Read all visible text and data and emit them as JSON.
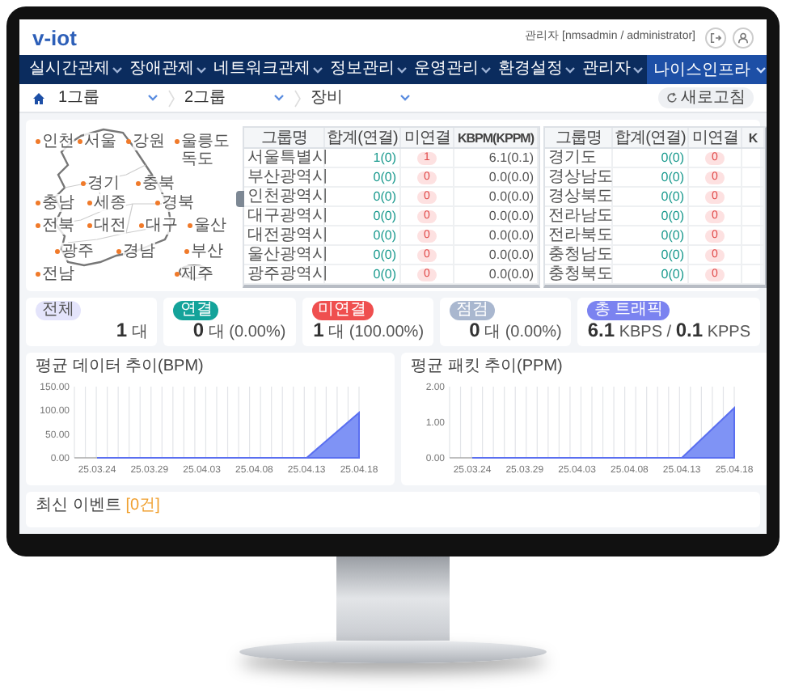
{
  "header": {
    "logo": "v-iot",
    "user": "관리자 [nmsadmin / administrator]"
  },
  "nav": {
    "items": [
      {
        "label": "실시간관제"
      },
      {
        "label": "장애관제"
      },
      {
        "label": "네트워크관제"
      },
      {
        "label": "정보관리"
      },
      {
        "label": "운영관리"
      },
      {
        "label": "환경설정"
      },
      {
        "label": "관리자"
      }
    ],
    "company": "나이스인프라"
  },
  "breadcrumb": {
    "selects": [
      "1그룹",
      "2그룹",
      "장비"
    ],
    "refresh": "새로고침"
  },
  "map": {
    "regions": [
      "인천",
      "서울",
      "강원",
      "울릉도 독도",
      "경기",
      "충북",
      "충남",
      "세종",
      "경북",
      "전북",
      "대전",
      "대구",
      "울산",
      "광주",
      "경남",
      "부산",
      "전남",
      "제주"
    ]
  },
  "tables": [
    {
      "columns": [
        "그룹명",
        "합계(연결)",
        "미연결",
        "KBPM(KPPM)"
      ],
      "rows": [
        [
          "서울특별시",
          "1(0)",
          "1",
          "6.1(0.1)"
        ],
        [
          "부산광역시",
          "0(0)",
          "0",
          "0.0(0.0)"
        ],
        [
          "인천광역시",
          "0(0)",
          "0",
          "0.0(0.0)"
        ],
        [
          "대구광역시",
          "0(0)",
          "0",
          "0.0(0.0)"
        ],
        [
          "대전광역시",
          "0(0)",
          "0",
          "0.0(0.0)"
        ],
        [
          "울산광역시",
          "0(0)",
          "0",
          "0.0(0.0)"
        ],
        [
          "광주광역시",
          "0(0)",
          "0",
          "0.0(0.0)"
        ]
      ]
    },
    {
      "columns": [
        "그룹명",
        "합계(연결)",
        "미연결",
        "K"
      ],
      "rows": [
        [
          "경기도",
          "0(0)",
          "0"
        ],
        [
          "경상남도",
          "0(0)",
          "0"
        ],
        [
          "경상북도",
          "0(0)",
          "0"
        ],
        [
          "전라남도",
          "0(0)",
          "0"
        ],
        [
          "전라북도",
          "0(0)",
          "0"
        ],
        [
          "충청남도",
          "0(0)",
          "0"
        ],
        [
          "충청북도",
          "0(0)",
          "0"
        ]
      ]
    }
  ],
  "stats": [
    {
      "label": "전체",
      "color": "#e4e4fb",
      "value": "**1** 대"
    },
    {
      "label": "연결",
      "color": "#14a39a",
      "value": "**0** 대 (0.00%)"
    },
    {
      "label": "미연결",
      "color": "#ef4f4f",
      "value": "**1** 대 (100.00%)"
    },
    {
      "label": "점검",
      "color": "#a9b7cf",
      "value": "**0** 대 (0.00%)"
    },
    {
      "label": "총 트래픽",
      "color": "#7b83f0",
      "value": "**6.1** KBPS / **0.1** KPPS"
    }
  ],
  "charts": [
    {
      "chart_data": {
        "type": "area",
        "title": "평균 데이터 추이(BPM)",
        "categories": [
          "25.03.24",
          "25.03.29",
          "25.04.03",
          "25.04.08",
          "25.04.13",
          "25.04.18"
        ],
        "values": [
          0,
          0,
          0,
          0,
          0,
          95
        ],
        "ylim": [
          0,
          150
        ],
        "yticks": [
          {
            "value": 0,
            "label": "0.00"
          },
          {
            "value": 50,
            "label": "50.00"
          },
          {
            "value": 100,
            "label": "100.00"
          },
          {
            "value": 150,
            "label": "150.00"
          }
        ],
        "grid": true
      }
    },
    {
      "chart_data": {
        "type": "area",
        "title": "평균 패킷 추이(PPM)",
        "categories": [
          "25.03.24",
          "25.03.29",
          "25.04.03",
          "25.04.08",
          "25.04.13",
          "25.04.18"
        ],
        "values": [
          0,
          0,
          0,
          0,
          0,
          1.4
        ],
        "ylim": [
          0,
          2
        ],
        "yticks": [
          {
            "value": 0,
            "label": "0.00"
          },
          {
            "value": 1,
            "label": "1.00"
          },
          {
            "value": 2,
            "label": "2.00"
          }
        ],
        "grid": true
      }
    }
  ],
  "events": {
    "title": "최신 이벤트",
    "count": "[0건]"
  }
}
